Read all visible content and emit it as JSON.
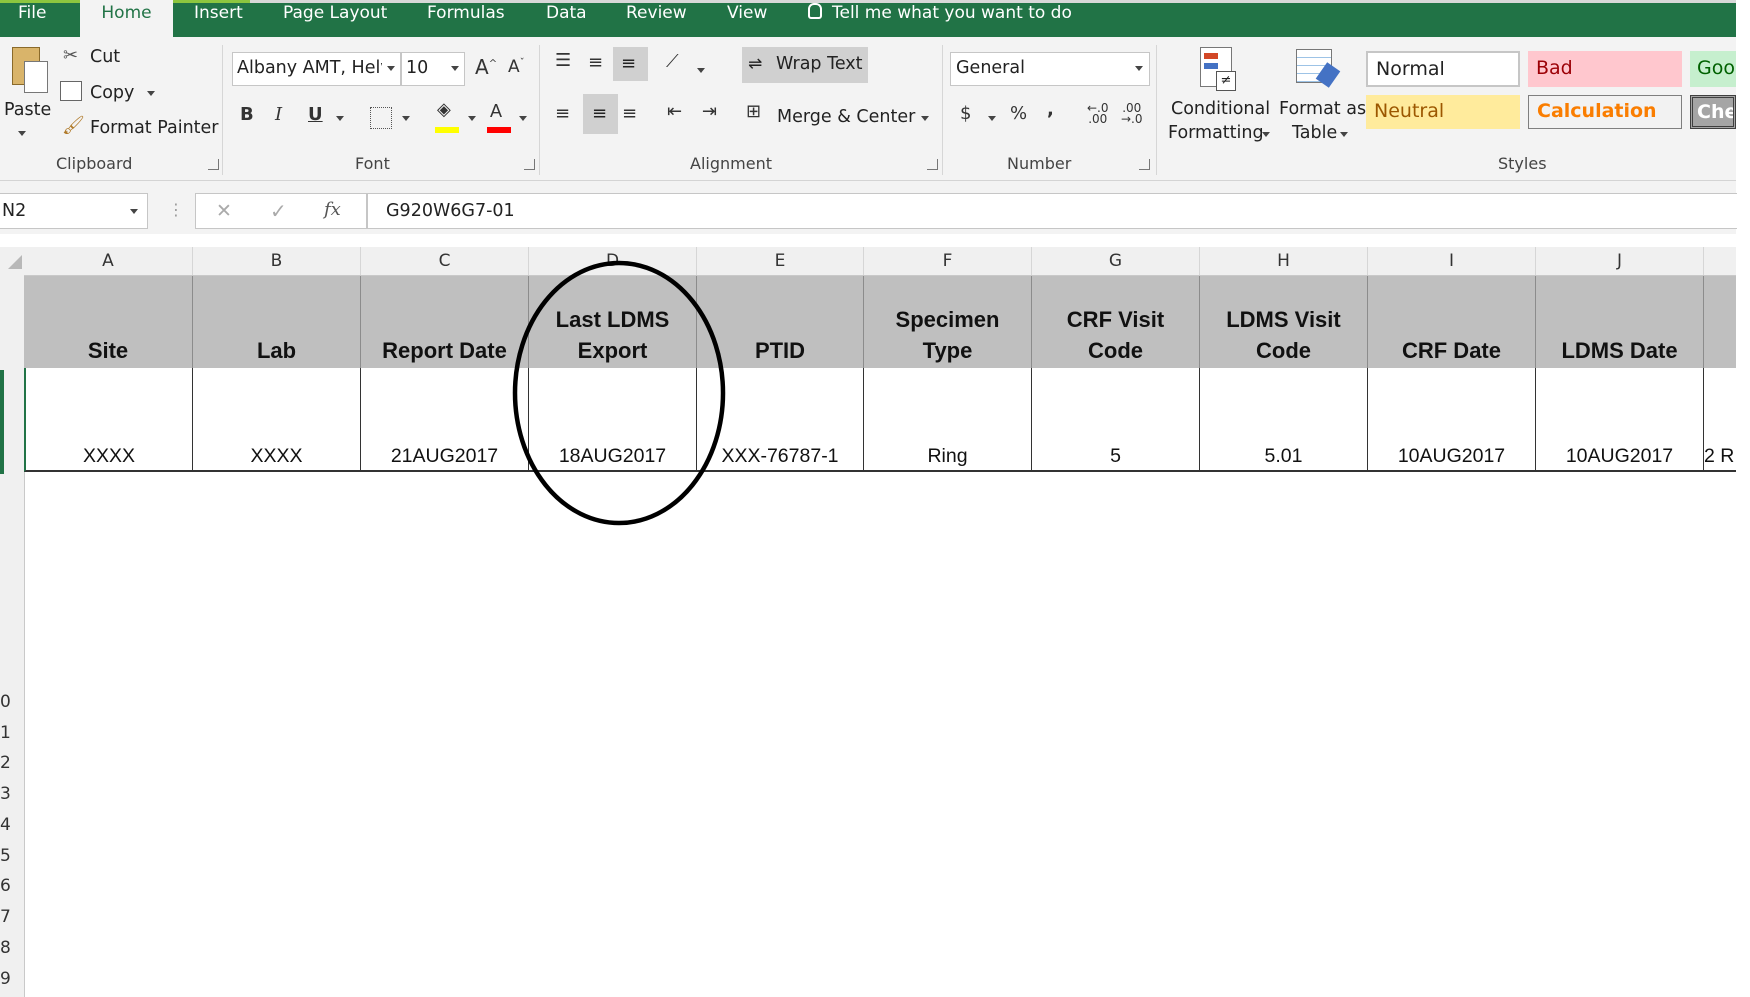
{
  "tabs": [
    {
      "label": "File"
    },
    {
      "label": "Home"
    },
    {
      "label": "Insert"
    },
    {
      "label": "Page Layout"
    },
    {
      "label": "Formulas"
    },
    {
      "label": "Data"
    },
    {
      "label": "Review"
    },
    {
      "label": "View"
    }
  ],
  "tell_me": "Tell me what you want to do",
  "clipboard": {
    "paste": "Paste",
    "cut": "Cut",
    "copy": "Copy",
    "format_painter": "Format Painter",
    "group": "Clipboard"
  },
  "font": {
    "name": "Albany AMT, Helv",
    "size": "10",
    "bold": "B",
    "italic": "I",
    "underline": "U",
    "group": "Font"
  },
  "alignment": {
    "wrap_text": "Wrap Text",
    "merge_center": "Merge & Center",
    "group": "Alignment"
  },
  "number": {
    "format": "General",
    "currency": "$",
    "percent": "%",
    "comma": ",",
    "group": "Number"
  },
  "styles": {
    "conditional_formatting_1": "Conditional",
    "conditional_formatting_2": "Formatting",
    "format_table_1": "Format as",
    "format_table_2": "Table",
    "normal": "Normal",
    "bad": "Bad",
    "good": "Goo",
    "neutral": "Neutral",
    "calculation": "Calculation",
    "check": "Che",
    "group": "Styles",
    "colors": {
      "bad_bg": "#ffc7ce",
      "bad_fg": "#9c0006",
      "good_bg": "#c6efce",
      "good_fg": "#006100",
      "neutral_bg": "#ffeb9c",
      "neutral_fg": "#9c5700",
      "calc_fg": "#fa7d00",
      "check_bg": "#a5a5a5"
    }
  },
  "formula_bar": {
    "name_box": "N2",
    "cancel": "✕",
    "enter": "✓",
    "fx": "fx",
    "value": "G920W6G7-01"
  },
  "columns": [
    "A",
    "B",
    "C",
    "D",
    "E",
    "F",
    "G",
    "H",
    "I",
    "J"
  ],
  "row_numbers": [
    "0",
    "1",
    "2",
    "3",
    "4",
    "5",
    "6",
    "7",
    "8",
    "9"
  ],
  "table": {
    "headers": [
      "Site",
      "Lab",
      "Report Date",
      "Last LDMS Export",
      "PTID",
      "Specimen Type",
      "CRF Visit Code",
      "LDMS Visit Code",
      "CRF Date",
      "LDMS Date"
    ],
    "row": [
      "XXXX",
      "XXXX",
      "21AUG2017",
      "18AUG2017",
      "XXX-76787-1",
      "Ring",
      "5",
      "5.01",
      "10AUG2017",
      "10AUG2017"
    ],
    "partial_cell": "2 R"
  }
}
